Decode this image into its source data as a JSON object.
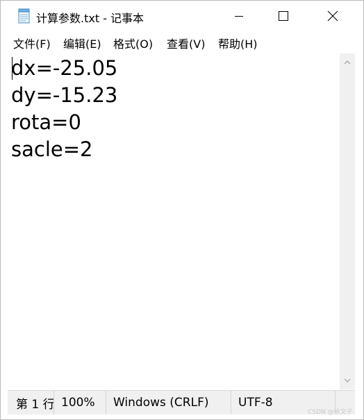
{
  "window": {
    "title": "计算参数.txt - 记事本",
    "app_icon": "notepad-icon",
    "controls": {
      "minimize_icon": "minimize-icon",
      "maximize_icon": "maximize-icon",
      "close_icon": "close-icon"
    }
  },
  "menubar": {
    "items": [
      {
        "label": "文件(F)"
      },
      {
        "label": "编辑(E)"
      },
      {
        "label": "格式(O)"
      },
      {
        "label": "查看(V)"
      },
      {
        "label": "帮助(H)"
      }
    ]
  },
  "editor": {
    "content": "dx=-25.05\ndy=-15.23\nrota=0\nsacle=2"
  },
  "statusbar": {
    "position": "第 1 行",
    "zoom": "100%",
    "line_ending": "Windows (CRLF)",
    "encoding": "UTF-8"
  },
  "watermark": "CSDN @依文子",
  "colors": {
    "statusbar_bg": "#f0f0f0",
    "scrollbar_bg": "#f0f0f0"
  }
}
